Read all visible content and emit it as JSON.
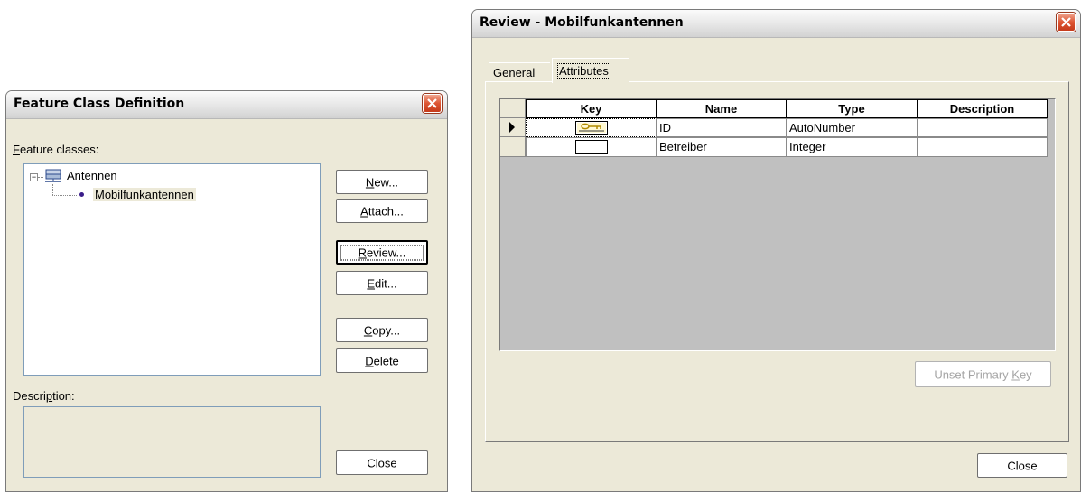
{
  "feature_dialog": {
    "title": "Feature Class Definition",
    "feature_classes_label": "Feature classes:",
    "tree": {
      "root": "Antennen",
      "child": "Mobilfunkantennen"
    },
    "buttons": {
      "new": "New...",
      "attach": "Attach...",
      "review": "Review...",
      "edit": "Edit...",
      "copy": "Copy...",
      "delete": "Delete",
      "close": "Close"
    },
    "description_label": "Description:",
    "description_value": ""
  },
  "review_dialog": {
    "title": "Review - Mobilfunkantennen",
    "tabs": [
      "General",
      "Attributes"
    ],
    "active_tab": "Attributes",
    "grid": {
      "columns": [
        "Key",
        "Name",
        "Type",
        "Description"
      ],
      "rows": [
        {
          "key": "primary-key",
          "name": "ID",
          "type": "AutoNumber",
          "description": "",
          "current": true
        },
        {
          "key": "",
          "name": "Betreiber",
          "type": "Integer",
          "description": "",
          "current": false
        }
      ]
    },
    "unset_button": "Unset Primary Key",
    "close_button": "Close"
  },
  "icons": {
    "close": "close-icon",
    "tree_node": "server-icon",
    "key": "key-icon",
    "row_pointer": "row-pointer-icon"
  },
  "colors": {
    "close_red": "#dd5533",
    "grid_bg": "#c0c0c0",
    "tree_selected_bg": "#ece9d8",
    "tree_bullet": "#3a1d8a"
  }
}
